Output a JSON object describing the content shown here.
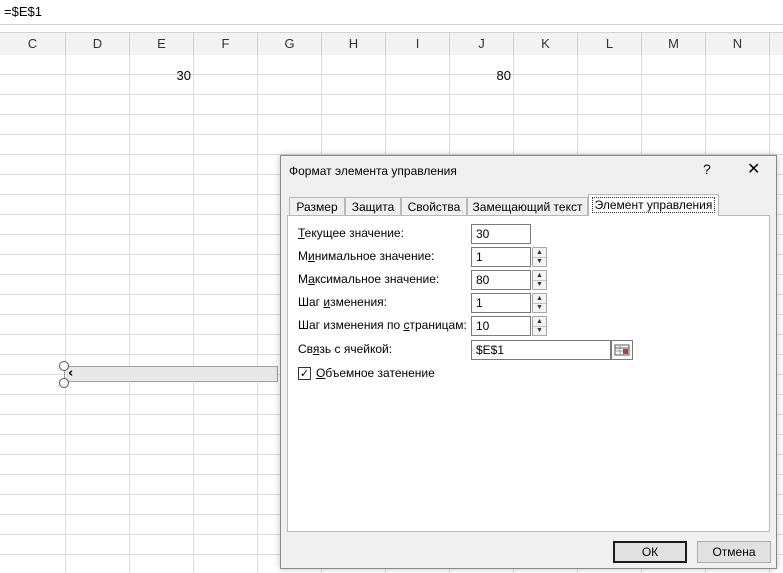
{
  "formula_bar": {
    "text": "=$E$1"
  },
  "columns": [
    "C",
    "D",
    "E",
    "F",
    "G",
    "H",
    "I",
    "J",
    "K",
    "L",
    "M",
    "N"
  ],
  "cells": {
    "E1": "30",
    "J1": "80"
  },
  "dialog": {
    "title": "Формат элемента управления",
    "help": "?",
    "close": "✕",
    "tabs": [
      "Размер",
      "Защита",
      "Свойства",
      "Замещающий текст",
      "Элемент управления"
    ],
    "active_tab": "Элемент управления",
    "fields": {
      "current_label_u": "Т",
      "current_label_rest": "екущее значение:",
      "current_value": "30",
      "min_label_pre": "М",
      "min_label_u": "и",
      "min_label_rest": "нимальное значение:",
      "min_value": "1",
      "max_label_pre": "М",
      "max_label_u": "а",
      "max_label_rest": "ксимальное значение:",
      "max_value": "80",
      "step_label_pre": "Шаг ",
      "step_label_u": "и",
      "step_label_rest": "зменения:",
      "step_value": "1",
      "page_label_pre": "Шаг изменения по ",
      "page_label_u": "с",
      "page_label_rest": "траницам:",
      "page_value": "10",
      "link_label_pre": "Св",
      "link_label_u": "я",
      "link_label_rest": "зь с ячейкой:",
      "link_value": "$E$1"
    },
    "checkbox": {
      "checked": true,
      "mark": "✓",
      "label_u": "О",
      "label_rest": "бъемное затенение"
    },
    "ok_label": "ОК",
    "cancel_label": "Отмена"
  },
  "colors": {
    "header_bg": "#f3f3f3",
    "dialog_bg": "#f0f0f0",
    "grid_line": "#dcdcdc"
  },
  "icons": {
    "scroll_left": "‹",
    "ref_button": "collapse-dialog-icon"
  }
}
